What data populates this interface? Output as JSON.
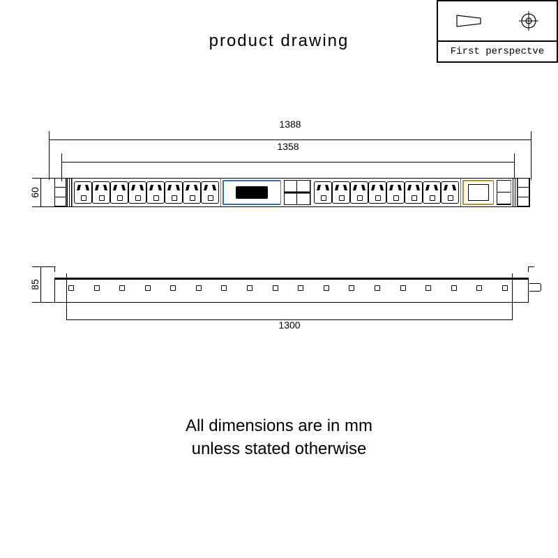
{
  "title": "product  drawing",
  "legend": {
    "label": "First perspectve"
  },
  "note_line1": "All dimensions are in mm",
  "note_line2": "unless stated otherwise",
  "dims": {
    "overall_length": "1388",
    "body_length": "1358",
    "height_front": "60",
    "height_side": "85",
    "mounting_centers": "1300"
  }
}
